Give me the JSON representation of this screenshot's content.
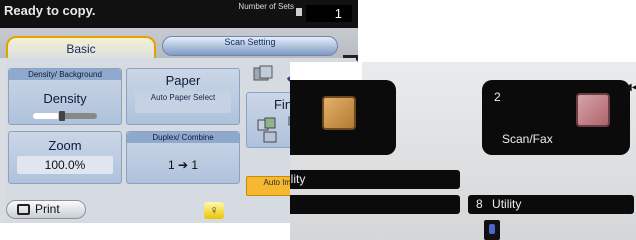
{
  "left_panel": {
    "status": "Ready to copy.",
    "sets_label": "Number of Sets",
    "sets_value": "1",
    "tabs": {
      "basic": "Basic",
      "scan_setting": "Scan Setting"
    },
    "density": {
      "header": "Density/ Background",
      "title": "Density"
    },
    "paper": {
      "title": "Paper",
      "value": "Auto Paper Select"
    },
    "finishing": {
      "title": "Finishing"
    },
    "zoom": {
      "title": "Zoom",
      "value": "100.0%"
    },
    "duplex": {
      "header": "Duplex/ Combine",
      "value": "1 ➔ 1"
    },
    "auto_rotation": "Auto Image Rotation",
    "print": "Print"
  },
  "right_panel": {
    "copy_box_number": "",
    "scan_box_number": "2",
    "scan_box_label": "Scan/Fax",
    "utility_left": "ility",
    "utility_right_number": "8",
    "utility_right_label": "Utility"
  },
  "colors": {
    "accent_orange": "#f5b830",
    "panel_blue": "#afc2dc",
    "menu_black": "#0b0b0b"
  }
}
